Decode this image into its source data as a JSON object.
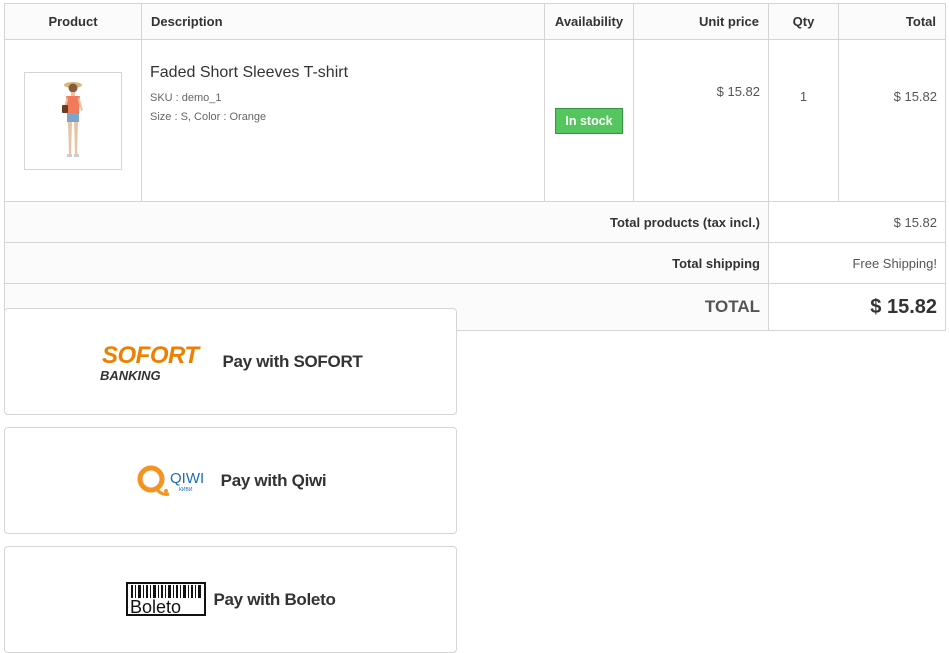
{
  "table": {
    "headers": {
      "product": "Product",
      "description": "Description",
      "availability": "Availability",
      "unit_price": "Unit price",
      "qty": "Qty",
      "total": "Total"
    },
    "item": {
      "name": "Faded Short Sleeves T-shirt",
      "sku": "SKU : demo_1",
      "attributes": "Size : S, Color : Orange",
      "availability": "In stock",
      "unit_price": "$ 15.82",
      "qty": "1",
      "total": "$ 15.82"
    },
    "summary": {
      "products_label": "Total products (tax incl.)",
      "products_value": "$ 15.82",
      "shipping_label": "Total shipping",
      "shipping_value": "Free Shipping!",
      "total_label": "TOTAL",
      "total_value": "$ 15.82"
    }
  },
  "payments": {
    "sofort": {
      "logo_top": "SOFORT",
      "logo_bottom": "BANKING",
      "label": "Pay with SOFORT"
    },
    "qiwi": {
      "logo_text": "QIWI",
      "logo_sub": "КИВИ",
      "label": "Pay with Qiwi"
    },
    "boleto": {
      "logo_text": "Boleto",
      "label": "Pay with Boleto"
    }
  },
  "colors": {
    "in_stock": "#55c65e",
    "sofort_orange": "#ee7f00",
    "qiwi_orange": "#f39322",
    "qiwi_blue": "#1a6fb5"
  }
}
